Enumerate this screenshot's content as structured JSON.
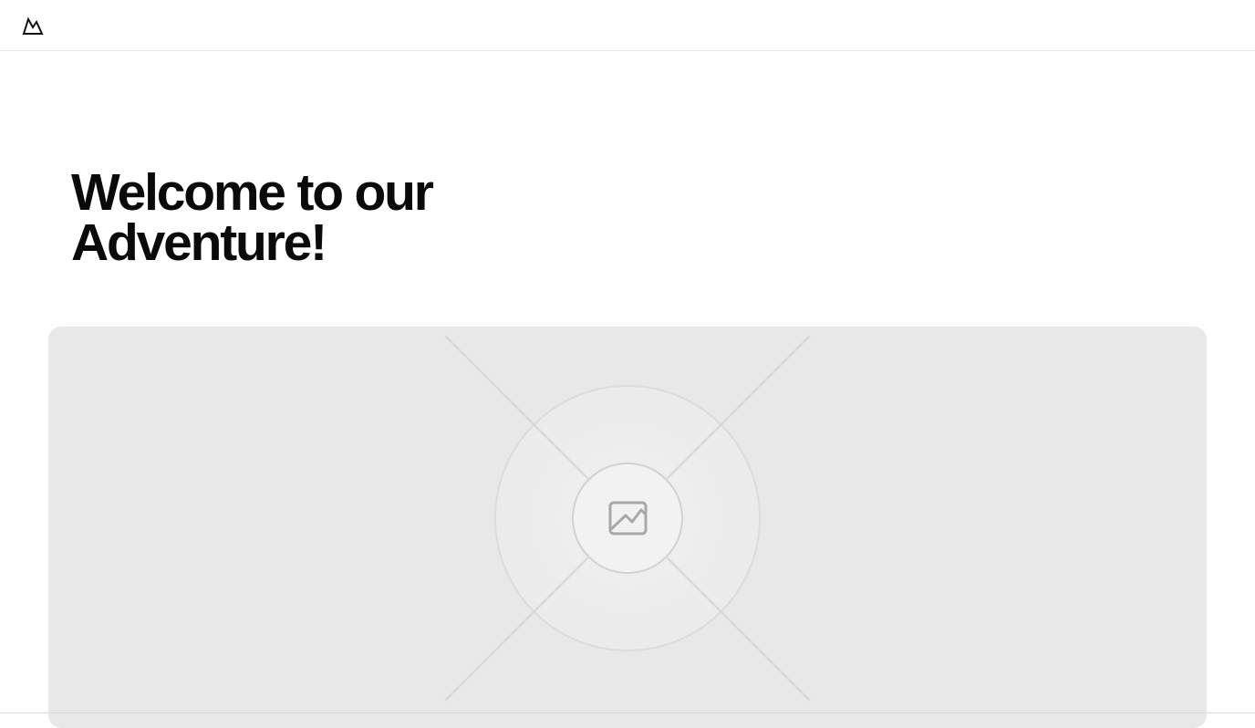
{
  "header": {
    "logo_icon": "mountain-logo-icon"
  },
  "hero": {
    "title_line1": "Welcome to our",
    "title_line2": "Adventure!"
  },
  "media": {
    "placeholder_icon": "image-placeholder-icon",
    "background_color": "#e8e8e8"
  }
}
